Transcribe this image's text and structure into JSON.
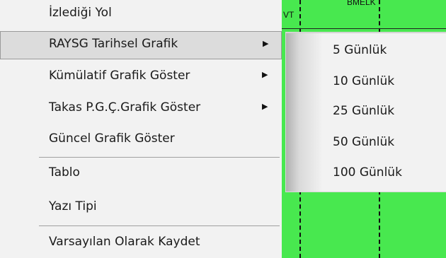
{
  "menu": {
    "items": [
      {
        "label": "İzlediği Yol",
        "has_submenu": false
      },
      {
        "label": "RAYSG Tarihsel Grafik",
        "has_submenu": true,
        "active": true
      },
      {
        "label": "Kümülatif Grafik Göster",
        "has_submenu": true
      },
      {
        "label": "Takas P.G.Ç.Grafik Göster",
        "has_submenu": true
      },
      {
        "label": "Güncel Grafik Göster",
        "has_submenu": false
      },
      {
        "label": "Tablo",
        "has_submenu": false
      },
      {
        "label": "Yazı Tipi",
        "has_submenu": false
      },
      {
        "label": "Varsayılan Olarak Kaydet",
        "has_submenu": false
      }
    ],
    "arrow_glyph": "▶"
  },
  "submenu": {
    "items": [
      {
        "label": "5 Günlük"
      },
      {
        "label": "10 Günlük"
      },
      {
        "label": "25 Günlük"
      },
      {
        "label": "50 Günlük"
      },
      {
        "label": "100 Günlük"
      }
    ]
  },
  "chart": {
    "labels": [
      "VT",
      "BMELK"
    ],
    "background_color": "#48e84f"
  },
  "colors": {
    "menu_bg": "#f2f2f2",
    "active_bg": "#dcdcdc",
    "separator": "#a0a0a0"
  }
}
